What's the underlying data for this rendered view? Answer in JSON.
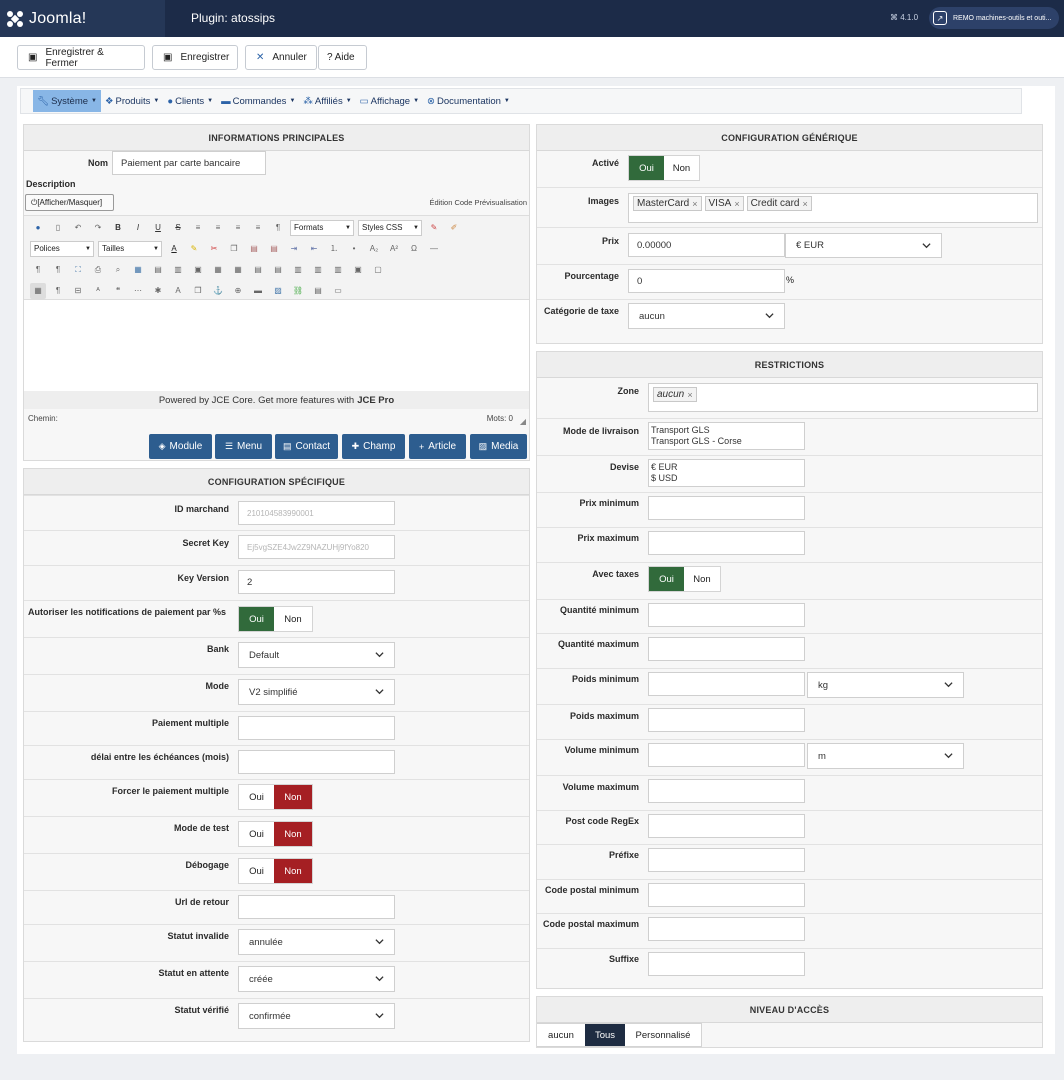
{
  "app": {
    "logo": "Joomla!",
    "page_title": "Plugin: atossips",
    "version": "4.1.0",
    "site_name": "REMO machines-outils et outi..."
  },
  "toolbar": {
    "save_close": "Enregistrer & Fermer",
    "save": "Enregistrer",
    "cancel": "Annuler",
    "help": "Aide"
  },
  "menu": [
    {
      "label": "Système",
      "icon": "wrench-icon"
    },
    {
      "label": "Produits",
      "icon": "cubes-icon"
    },
    {
      "label": "Clients",
      "icon": "user-icon"
    },
    {
      "label": "Commandes",
      "icon": "credit-card-icon"
    },
    {
      "label": "Affiliés",
      "icon": "users-icon"
    },
    {
      "label": "Affichage",
      "icon": "monitor-icon"
    },
    {
      "label": "Documentation",
      "icon": "lifebuoy-icon"
    }
  ],
  "main_info": {
    "heading": "INFORMATIONS PRINCIPALES",
    "name_label": "Nom",
    "name_value": "Paiement par carte bancaire",
    "description_label": "Description",
    "toggle_editor": "[Afficher/Masquer]",
    "tabs_right": "Édition Code Prévisualisation",
    "formats": "Formats",
    "styles": "Styles CSS",
    "fonts": "Polices",
    "sizes": "Tailles",
    "powered_prefix": "Powered by JCE Core. Get more features with ",
    "powered_brand": "JCE Pro",
    "path_label": "Chemin:",
    "word_count": "Mots: 0",
    "buttons": [
      "Module",
      "Menu",
      "Contact",
      "Champ",
      "Article",
      "Media"
    ]
  },
  "specific": {
    "heading": "CONFIGURATION SPÉCIFIQUE",
    "merchant_id_label": "ID marchand",
    "merchant_id": "210104583990001",
    "secret_key_label": "Secret Key",
    "secret_key": "Ej5vgSZE4Jw2Z9NAZUHj9fYo820",
    "key_version_label": "Key Version",
    "key_version": "2",
    "notif_label": "Autoriser les notifications de paiement par %s",
    "bank_label": "Bank",
    "bank": "Default",
    "mode_label": "Mode",
    "mode": "V2 simplifié",
    "multi_label": "Paiement multiple",
    "delay_label": "délai entre les échéances (mois)",
    "force_label": "Forcer le paiement multiple",
    "test_label": "Mode de test",
    "debug_label": "Débogage",
    "return_label": "Url de retour",
    "invalid_label": "Statut invalide",
    "invalid": "annulée",
    "pending_label": "Statut en attente",
    "pending": "créée",
    "verified_label": "Statut vérifié",
    "verified": "confirmée",
    "yes": "Oui",
    "no": "Non"
  },
  "generic": {
    "heading": "CONFIGURATION GÉNÉRIQUE",
    "active_label": "Activé",
    "images_label": "Images",
    "images": [
      "MasterCard",
      "VISA",
      "Credit card"
    ],
    "price_label": "Prix",
    "price": "0.00000",
    "currency": "€ EUR",
    "percent_label": "Pourcentage",
    "percent": "0",
    "percent_sign": "%",
    "tax_label": "Catégorie de taxe",
    "tax": "aucun"
  },
  "restrictions": {
    "heading": "RESTRICTIONS",
    "zone_label": "Zone",
    "zone_tag": "aucun",
    "shipping_label": "Mode de livraison",
    "shipping": [
      "Transport GLS",
      "Transport GLS - Corse"
    ],
    "currency_label": "Devise",
    "currencies": [
      "€ EUR",
      "$ USD"
    ],
    "min_price": "Prix minimum",
    "max_price": "Prix maximum",
    "taxes_label": "Avec taxes",
    "min_qty": "Quantité minimum",
    "max_qty": "Quantité maximum",
    "min_weight": "Poids minimum",
    "weight_unit": "kg",
    "max_weight": "Poids maximum",
    "min_volume": "Volume minimum",
    "volume_unit": "m",
    "max_volume": "Volume maximum",
    "postcode_regex": "Post code RegEx",
    "prefix": "Préfixe",
    "min_postcode": "Code postal minimum",
    "max_postcode": "Code postal maximum",
    "suffix": "Suffixe"
  },
  "access": {
    "heading": "NIVEAU D'ACCÈS",
    "options": [
      "aucun",
      "Tous",
      "Personnalisé"
    ]
  },
  "colors": {
    "topbar": "#1c2b48",
    "green": "#316a3b",
    "red": "#a51f23",
    "blue_btn": "#2d5d8f"
  }
}
